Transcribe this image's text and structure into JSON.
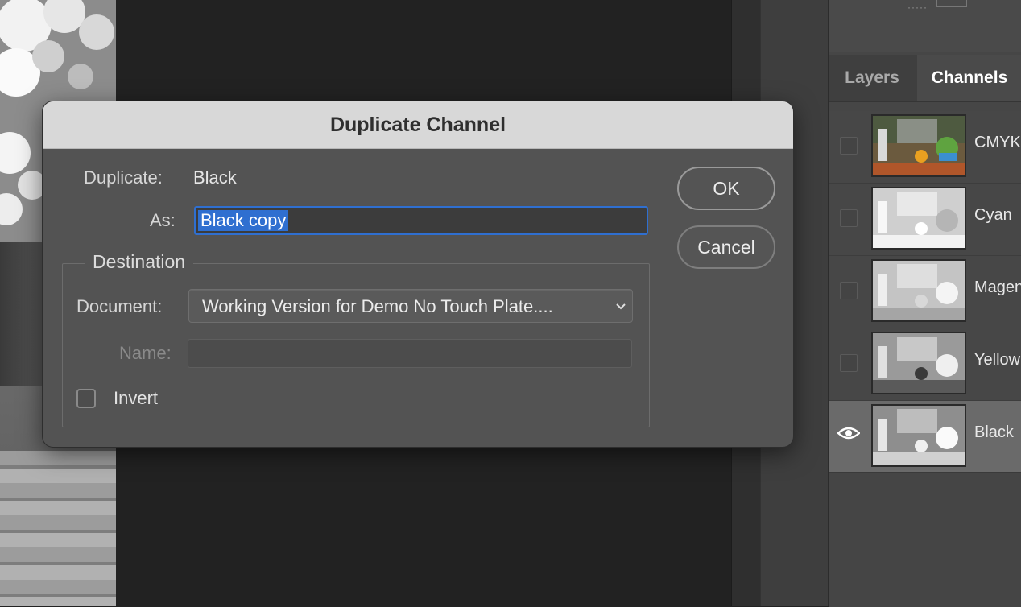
{
  "dialog": {
    "title": "Duplicate Channel",
    "duplicate_label": "Duplicate:",
    "duplicate_value": "Black",
    "as_label": "As:",
    "as_value": "Black copy",
    "destination_legend": "Destination",
    "document_label": "Document:",
    "document_value": "Working Version for Demo No Touch Plate....",
    "name_label": "Name:",
    "name_value": "",
    "invert_label": "Invert",
    "invert_checked": false,
    "ok_label": "OK",
    "cancel_label": "Cancel",
    "accent_color": "#2f6fd0"
  },
  "panel": {
    "tabs": [
      {
        "label": "Layers",
        "active": false
      },
      {
        "label": "Channels",
        "active": true
      }
    ],
    "channels": [
      {
        "name": "CMYK",
        "visible": false,
        "selected": false,
        "icon": "visibility-box"
      },
      {
        "name": "Cyan",
        "visible": false,
        "selected": false,
        "icon": "visibility-box"
      },
      {
        "name": "Magenta",
        "visible": false,
        "selected": false,
        "icon": "visibility-box"
      },
      {
        "name": "Yellow",
        "visible": false,
        "selected": false,
        "icon": "visibility-box"
      },
      {
        "name": "Black",
        "visible": true,
        "selected": true,
        "icon": "eye-icon"
      }
    ]
  }
}
